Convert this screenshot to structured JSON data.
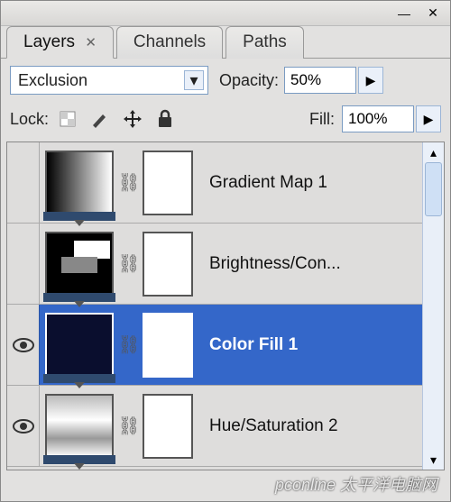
{
  "titlebar": {
    "minimize_glyph": "—",
    "close_glyph": "✕"
  },
  "tabs": {
    "layers": "Layers",
    "layers_close": "✕",
    "channels": "Channels",
    "paths": "Paths"
  },
  "blend": {
    "mode": "Exclusion",
    "opacity_label": "Opacity:",
    "opacity_value": "50%"
  },
  "lock": {
    "label": "Lock:",
    "fill_label": "Fill:",
    "fill_value": "100%"
  },
  "layers": [
    {
      "name": "Gradient Map 1",
      "visible": false,
      "selected": false,
      "thumb_class": "grad1"
    },
    {
      "name": "Brightness/Con...",
      "visible": false,
      "selected": false,
      "thumb_class": "bc"
    },
    {
      "name": "Color Fill 1",
      "visible": true,
      "selected": true,
      "thumb_class": "solid"
    },
    {
      "name": "Hue/Saturation 2",
      "visible": true,
      "selected": false,
      "thumb_class": "hue"
    }
  ],
  "arrow_right": "▶",
  "arrow_down": "▾",
  "arrow_up_s": "▴",
  "arrow_down_s": "▾",
  "watermark": "pconline 太平洋电脑网"
}
